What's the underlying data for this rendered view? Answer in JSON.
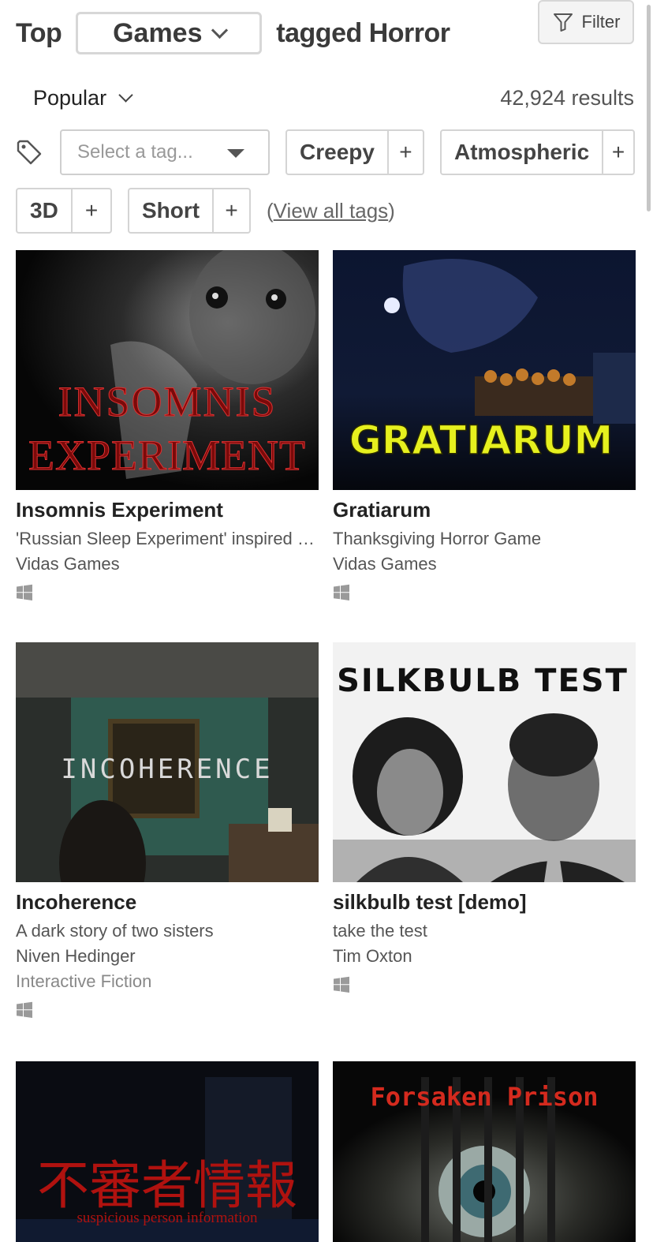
{
  "header": {
    "top_label": "Top",
    "type_selected": "Games",
    "tagged_label": "tagged Horror",
    "filter_label": "Filter"
  },
  "sort": {
    "selected": "Popular"
  },
  "results_label": "42,924 results",
  "tags": {
    "select_placeholder": "Select a tag...",
    "items": [
      {
        "label": "Creepy",
        "add": "+"
      },
      {
        "label": "Atmospheric",
        "add": "+"
      },
      {
        "label": "3D",
        "add": "+"
      },
      {
        "label": "Short",
        "add": "+"
      }
    ],
    "view_all_open": "(",
    "view_all_label": "View all tags",
    "view_all_close": ")"
  },
  "games": [
    {
      "title": "Insomnis Experiment",
      "description": "'Russian Sleep Experiment' inspired horror game",
      "author": "Vidas Games",
      "platform_icon": "windows-icon",
      "cover_text": [
        "INSOMNIS",
        "EXPERIMENT"
      ],
      "cover_color": "#7a0a0a"
    },
    {
      "title": "Gratiarum",
      "description": "Thanksgiving Horror Game",
      "author": "Vidas Games",
      "platform_icon": "windows-icon",
      "cover_text": [
        "GRATIARUM"
      ],
      "cover_color": "#e6f01e"
    },
    {
      "title": "Incoherence",
      "description": "A dark story of two sisters",
      "author": "Niven Hedinger",
      "genre": "Interactive Fiction",
      "platform_icon": "windows-icon",
      "cover_text": [
        "INCOHERENCE"
      ],
      "cover_color": "#d9d9d9"
    },
    {
      "title": "silkbulb test [demo]",
      "description": "take the test",
      "author": "Tim Oxton",
      "platform_icon": "windows-icon",
      "cover_text": [
        "SILKBULB TEST"
      ],
      "cover_color": "#111111"
    },
    {
      "cover_text": [
        "不審者情報",
        "suspicious person information"
      ],
      "cover_color": "#b0120f"
    },
    {
      "cover_text": [
        "Forsaken Prison"
      ],
      "cover_color": "#d42a1e"
    }
  ]
}
